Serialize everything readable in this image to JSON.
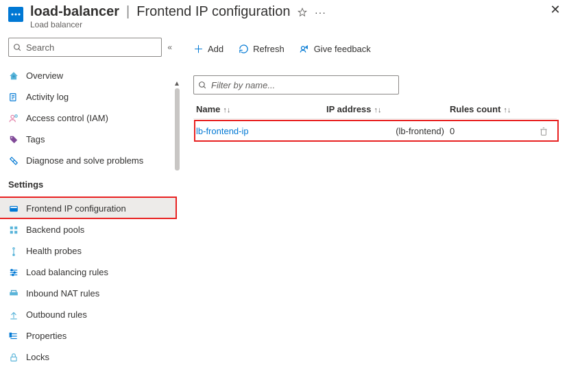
{
  "colors": {
    "accent": "#0078d4",
    "highlight": "#e82020"
  },
  "header": {
    "resource": "load-balancer",
    "sep": "|",
    "page": "Frontend IP configuration",
    "subtitle": "Load balancer",
    "more": "···"
  },
  "sidebar": {
    "search_placeholder": "Search",
    "section_label": "Settings",
    "items": [
      {
        "icon": "overview",
        "label": "Overview"
      },
      {
        "icon": "activity",
        "label": "Activity log"
      },
      {
        "icon": "iam",
        "label": "Access control (IAM)"
      },
      {
        "icon": "tag",
        "label": "Tags"
      },
      {
        "icon": "diagnose",
        "label": "Diagnose and solve problems"
      }
    ],
    "settings_items": [
      {
        "icon": "frontend",
        "label": "Frontend IP configuration",
        "selected": true
      },
      {
        "icon": "backend",
        "label": "Backend pools"
      },
      {
        "icon": "health",
        "label": "Health probes"
      },
      {
        "icon": "lbrules",
        "label": "Load balancing rules"
      },
      {
        "icon": "nat",
        "label": "Inbound NAT rules"
      },
      {
        "icon": "outbound",
        "label": "Outbound rules"
      },
      {
        "icon": "properties",
        "label": "Properties"
      },
      {
        "icon": "locks",
        "label": "Locks"
      }
    ]
  },
  "toolbar": {
    "add": "Add",
    "refresh": "Refresh",
    "feedback": "Give feedback"
  },
  "filter": {
    "placeholder": "Filter by name..."
  },
  "table": {
    "columns": [
      "Name",
      "IP address",
      "Rules count"
    ],
    "sort_glyph": "↑↓",
    "rows": [
      {
        "name": "lb-frontend-ip",
        "ip": "(lb-frontend)",
        "rules": "0"
      }
    ]
  }
}
